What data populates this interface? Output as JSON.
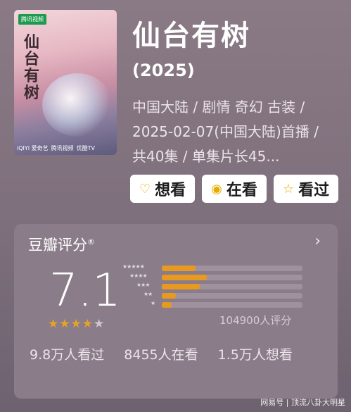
{
  "poster": {
    "tag": "腾讯视频",
    "calligraphy": "仙台有树",
    "logos": [
      "iQIYI 爱奇艺",
      "腾讯视频",
      "优酷TV"
    ]
  },
  "title": "仙台有树",
  "year": "(2025)",
  "meta": "中国大陆 / 剧情 奇幻 古装 / 2025-02-07(中国大陆)首播 / 共40集 / 单集片长45...",
  "buttons": [
    {
      "label": "想看",
      "icon": "heart-plus-icon"
    },
    {
      "label": "在看",
      "icon": "circle-dot-icon"
    },
    {
      "label": "看过",
      "icon": "star-outline-icon"
    }
  ],
  "rating": {
    "title": "豆瓣评分",
    "score": "7.1",
    "stars_filled": 3.5,
    "distribution": [
      {
        "stars": 5,
        "fraction": 0.24
      },
      {
        "stars": 4,
        "fraction": 0.32
      },
      {
        "stars": 3,
        "fraction": 0.27
      },
      {
        "stars": 2,
        "fraction": 0.1
      },
      {
        "stars": 1,
        "fraction": 0.07
      }
    ],
    "count": "104900人评分"
  },
  "stats": [
    "9.8万人看过",
    "8455人在看",
    "1.5万人想看"
  ],
  "watermark": "网易号 | 顶流八卦大明星",
  "colors": {
    "accent": "#e79a1f",
    "star": "#e7a227"
  }
}
